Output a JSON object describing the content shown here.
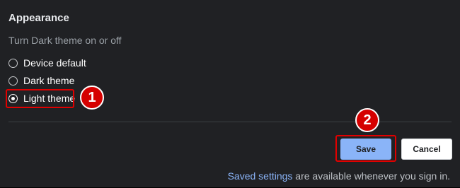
{
  "appearance": {
    "title": "Appearance",
    "subtitle": "Turn Dark theme on or off",
    "options": [
      {
        "label": "Device default",
        "checked": false
      },
      {
        "label": "Dark theme",
        "checked": false
      },
      {
        "label": "Light theme",
        "checked": true
      }
    ]
  },
  "annotations": {
    "step1": "1",
    "step2": "2",
    "highlight_color": "#e00000",
    "badge_color": "#d50000"
  },
  "actions": {
    "save_label": "Save",
    "cancel_label": "Cancel"
  },
  "footer": {
    "link_text": "Saved settings",
    "rest_text": " are available whenever you sign in."
  },
  "colors": {
    "background": "#202124",
    "accent": "#8ab4f8"
  }
}
